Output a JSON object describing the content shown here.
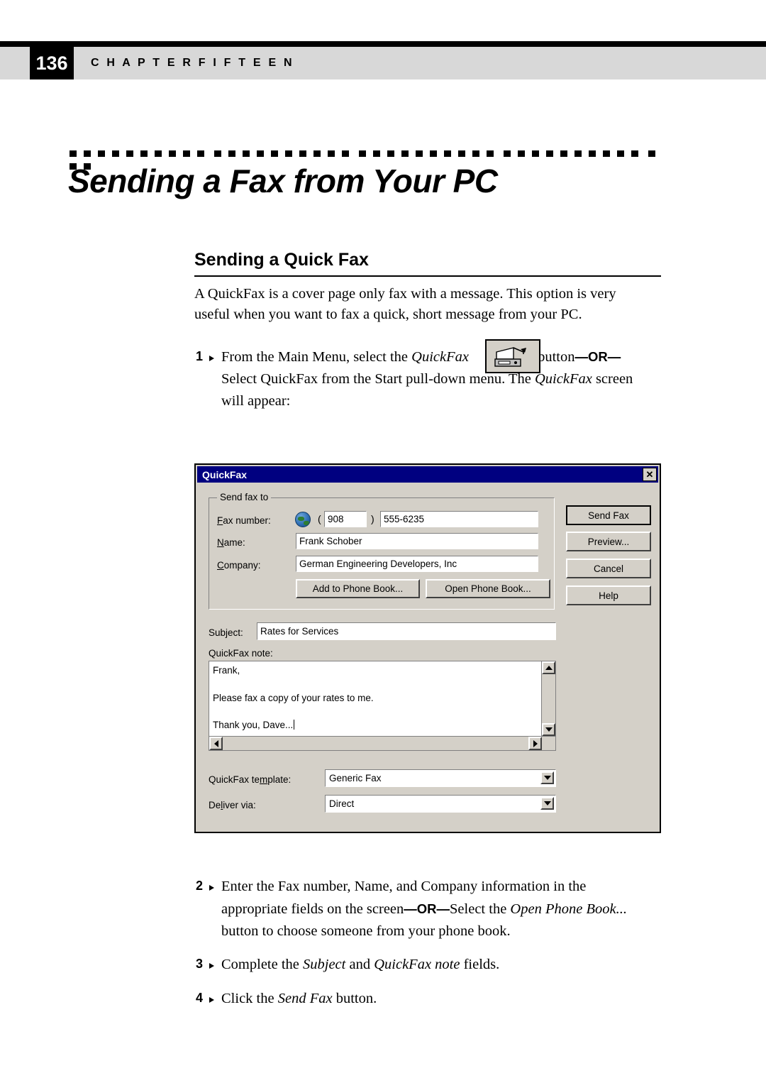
{
  "header": {
    "page_number": "136",
    "chapter_label": "C H A P T E R    F I F T E E N"
  },
  "title": "Sending a Fax from Your PC",
  "section": {
    "heading": "Sending a Quick Fax",
    "intro_line1": "A QuickFax is a cover page only fax with a message.  This option is very",
    "intro_line2": "useful when you want to fax a quick, short message from your PC."
  },
  "steps": {
    "one": {
      "number": "1",
      "line1_a": "From the Main Menu, select the ",
      "line1_italic": "QuickFax",
      "line1_b": "button",
      "line1_or": "—OR—",
      "line2_a": "Select QuickFax  from the Start pull-down menu.  The ",
      "line2_italic": "QuickFax",
      "line2_b": " screen",
      "line3": "will appear:"
    },
    "two": {
      "number": "2",
      "line1": "Enter the Fax number, Name, and Company information in the",
      "line2_a": "appropriate fields on the screen",
      "line2_or": "—OR—",
      "line2_b": "Select the ",
      "line2_italic": "Open Phone Book...",
      "line3": "button to choose someone from your phone book."
    },
    "three": {
      "number": "3",
      "text_a": "Complete the ",
      "text_italic1": "Subject",
      "text_b": " and ",
      "text_italic2": "QuickFax note",
      "text_c": " fields."
    },
    "four": {
      "number": "4",
      "text_a": "Click the ",
      "text_italic": "Send Fax",
      "text_b": " button."
    }
  },
  "dialog": {
    "title": "QuickFax",
    "close_label": "✕",
    "group_sendfaxto": "Send fax to",
    "labels": {
      "fax_number": "Fax number:",
      "name": "Name:",
      "company": "Company:",
      "subject": "Subject:",
      "quickfax_note": "QuickFax note:",
      "quickfax_template": "QuickFax template:",
      "deliver_via": "Deliver via:"
    },
    "values": {
      "area_code": "908",
      "fax_number": "555-6235",
      "name": "Frank Schober",
      "company": "German Engineering Developers, Inc",
      "subject": "Rates for Services",
      "template": "Generic Fax",
      "deliver_via": "Direct"
    },
    "note_lines": [
      "Frank,",
      "Please fax a copy of your rates to me.",
      "Thank you, Dave..."
    ],
    "buttons": {
      "add_to_phone_book": "Add to Phone Book...",
      "open_phone_book": "Open Phone Book...",
      "send_fax": "Send Fax",
      "preview": "Preview...",
      "cancel": "Cancel",
      "help": "Help"
    },
    "paren_open": "(",
    "paren_close": ")"
  },
  "colors": {
    "titlebar": "#000080",
    "dialog_face": "#d4d0c8",
    "header_band": "#d8d8d8"
  }
}
